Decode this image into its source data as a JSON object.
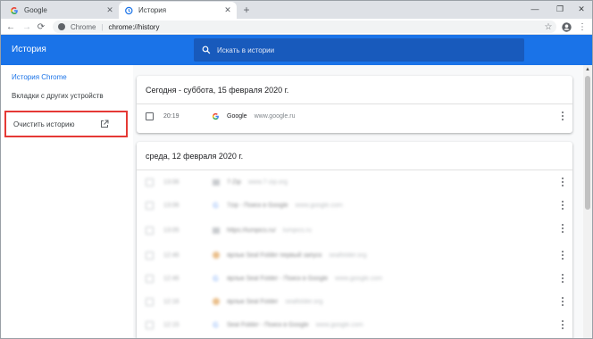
{
  "tabs": [
    {
      "title": "Google",
      "close": "✕"
    },
    {
      "title": "История",
      "close": "✕"
    }
  ],
  "new_tab": "+",
  "window_controls": {
    "minimize": "—",
    "maximize": "❐",
    "close": "✕"
  },
  "toolbar": {
    "back": "←",
    "forward": "→",
    "reload": "⟳",
    "omnibox_label": "Chrome",
    "omnibox_sep": "|",
    "url": "chrome://history",
    "star": "☆",
    "menu": "⋮"
  },
  "history": {
    "title": "История",
    "search_placeholder": "Искать в истории"
  },
  "sidebar": {
    "items": [
      {
        "label": "История Chrome",
        "selected": true
      },
      {
        "label": "Вкладки с других устройств",
        "selected": false
      }
    ],
    "clear_label": "Очистить историю"
  },
  "days": [
    {
      "header": "Сегодня - суббота, 15 февраля 2020 г.",
      "entries": [
        {
          "time": "20:19",
          "icon": "google-g-icon",
          "site": "Google",
          "domain": "www.google.ru"
        }
      ]
    },
    {
      "header": "среда, 12 февраля 2020 г.",
      "entries": [
        {
          "time": "13:06",
          "icon": "site-icon",
          "site": "7-Zip",
          "domain": "www.7-zip.org"
        },
        {
          "time": "13:06",
          "icon": "google-g-icon",
          "site": "7zip - Поиск в Google",
          "domain": "www.google.com"
        },
        {
          "time": "13:05",
          "icon": "site-icon",
          "site": "https://lumpics.ru/",
          "domain": "lumpics.ru"
        },
        {
          "time": "12:46",
          "icon": "orange-circle-icon",
          "site": "ярлык Seal Folder первый запуск",
          "domain": "sealfolder.org"
        },
        {
          "time": "12:46",
          "icon": "google-g-icon",
          "site": "ярлык Seal Folder - Поиск в Google",
          "domain": "www.google.com"
        },
        {
          "time": "12:16",
          "icon": "orange-circle-icon",
          "site": "ярлык Seal Folder",
          "domain": "sealfolder.org"
        },
        {
          "time": "12:15",
          "icon": "google-g-icon",
          "site": "Seal Folder - Поиск в Google",
          "domain": "www.google.com"
        }
      ]
    }
  ],
  "colors": {
    "accent": "#1a73e8",
    "highlight": "#e53935"
  }
}
